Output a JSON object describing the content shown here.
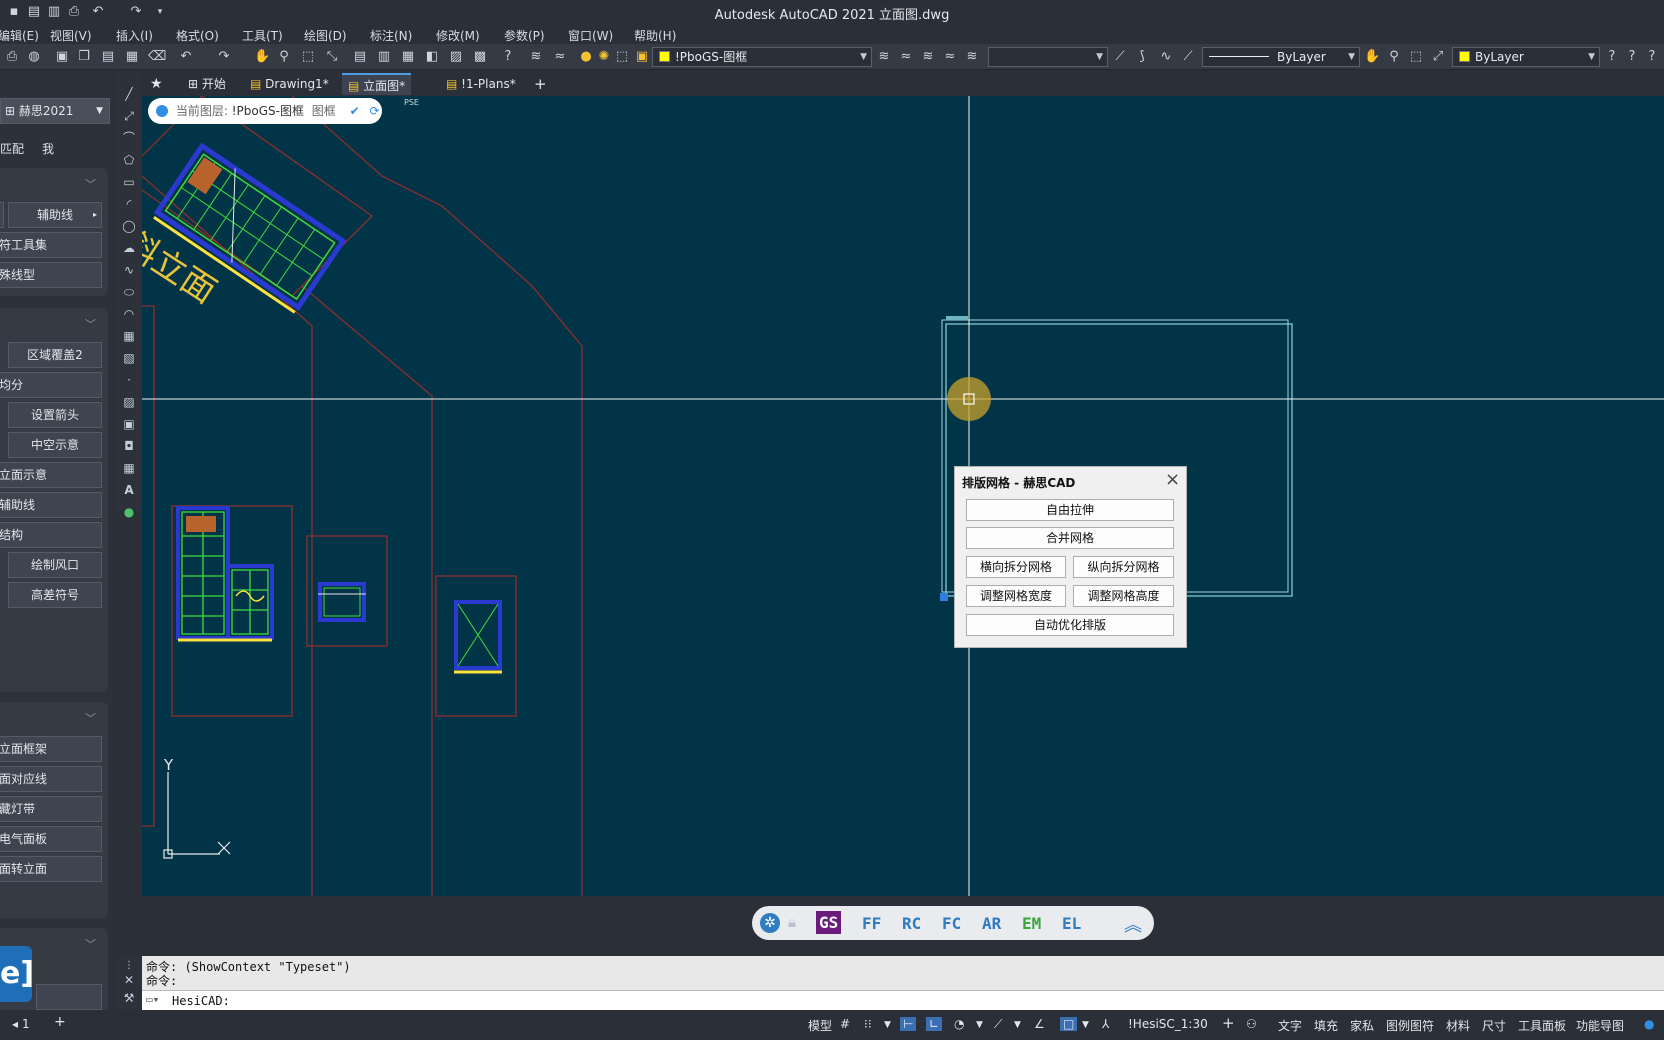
{
  "app": {
    "title": "Autodesk AutoCAD 2021    立面图.dwg"
  },
  "menu": [
    "编辑(E)",
    "视图(V)",
    "插入(I)",
    "格式(O)",
    "工具(T)",
    "绘图(D)",
    "标注(N)",
    "修改(M)",
    "参数(P)",
    "窗口(W)",
    "帮助(H)"
  ],
  "toolbar": {
    "layer_combo": "!PboGS-图框",
    "linetype_combo": "ByLayer",
    "color_combo": "ByLayer",
    "blank_combo": ""
  },
  "tabs": [
    {
      "label": "开始"
    },
    {
      "label": "Drawing1*"
    },
    {
      "label": "立面图*",
      "active": true
    },
    {
      "label": "!1-Plans*"
    }
  ],
  "tab_add": "+",
  "layer_pill": {
    "prefix": "当前图层: ",
    "layer": "!PboGS-图框",
    "suffix": "图框"
  },
  "pse_tag": "PSE",
  "left_panel": {
    "dropdown": "赫思2021",
    "mode_tabs": [
      "匹配",
      "我"
    ],
    "section1": [
      "辅助线",
      "符工具集",
      "殊线型"
    ],
    "section2": [
      "区域覆盖2",
      "均分",
      "设置箭头",
      "中空示意",
      "立面示意",
      "辅助线",
      "结构",
      "绘制风口",
      "高差符号"
    ],
    "section3": [
      "立面框架",
      "面对应线",
      "藏灯带",
      "电气面板",
      "面转立面"
    ],
    "logo": "e]"
  },
  "drawing": {
    "diagonal_label": "斜立面",
    "ucs_y": "Y",
    "ucs_x": "X"
  },
  "dialog": {
    "title": "排版网格 - 赫思CAD",
    "close": "×",
    "btn_free_stretch": "自由拉伸",
    "btn_merge": "合并网格",
    "btn_split_h": "横向拆分网格",
    "btn_split_v": "纵向拆分网格",
    "btn_adjust_w": "调整网格宽度",
    "btn_adjust_h": "调整网格高度",
    "btn_auto": "自动优化排版"
  },
  "pill_bar": {
    "items": [
      "GS",
      "FF",
      "RC",
      "FC",
      "AR",
      "EM",
      "EL"
    ],
    "active": "GS"
  },
  "command": {
    "line1": "命令: (ShowContext \"Typeset\")",
    "line2": "命令:",
    "prompt": "HesiCAD:"
  },
  "layout_tabs": {
    "current": "1",
    "add": "+"
  },
  "status": {
    "model": "模型",
    "scale": "!HesiSC_1:30",
    "items": [
      "文字",
      "填充",
      "家私",
      "图例图符",
      "材料",
      "尺寸",
      "工具面板",
      "功能导图"
    ]
  },
  "colors": {
    "canvas": "#023447",
    "accent_pill": "#6a1b7c",
    "dialog_bg": "#f0f0f0",
    "layer_yellow": "#ffff00"
  }
}
